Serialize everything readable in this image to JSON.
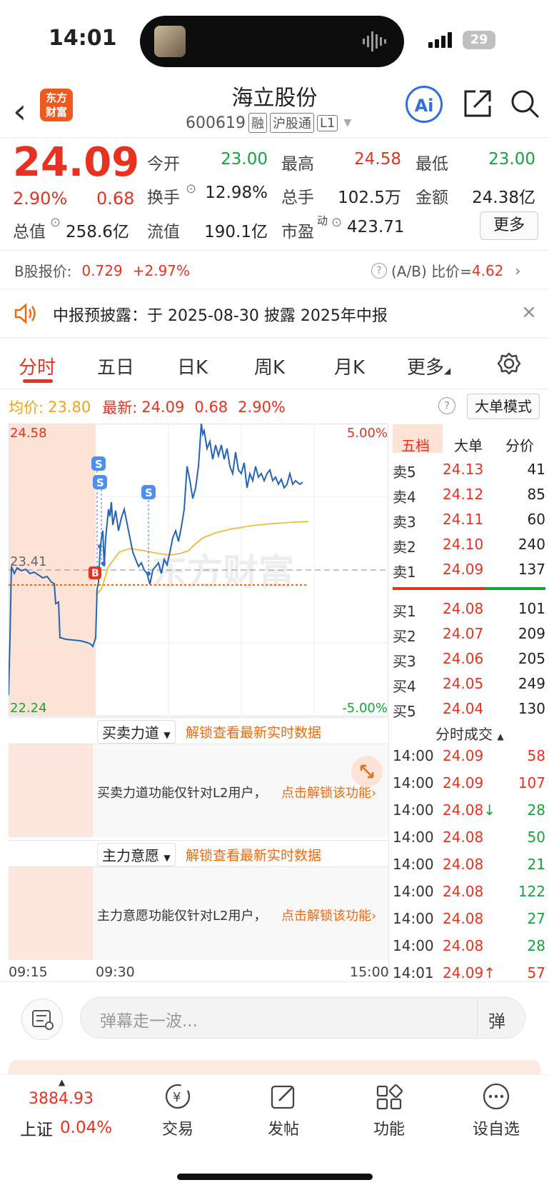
{
  "status_bar": {
    "time": "14:01",
    "battery": "29"
  },
  "header": {
    "logo_line1": "东方",
    "logo_line2": "财富",
    "name": "海立股份",
    "code": "600619",
    "tags": [
      "融",
      "沪股通",
      "L1"
    ],
    "ai_label": "Ai"
  },
  "quote": {
    "price": "24.09",
    "pct": "2.90%",
    "change": "0.68",
    "rows": [
      [
        {
          "label": "今开",
          "value": "23.00",
          "color": "green"
        },
        {
          "label": "最高",
          "value": "24.58",
          "color": "red"
        },
        {
          "label": "最低",
          "value": "23.00",
          "color": "green"
        }
      ],
      [
        {
          "label": "换手",
          "value": "12.98%",
          "color": "black"
        },
        {
          "label": "总手",
          "value": "102.5万",
          "color": "black"
        },
        {
          "label": "金额",
          "value": "24.38亿",
          "color": "black"
        }
      ],
      [
        {
          "label": "总值",
          "value": "258.6亿",
          "color": "black"
        },
        {
          "label": "流值",
          "value": "190.1亿",
          "color": "black"
        },
        {
          "label": "市盈",
          "value": "423.71",
          "color": "black"
        }
      ]
    ],
    "pe_sup": "动",
    "more": "更多"
  },
  "bshare": {
    "label": "B股报价:",
    "price": "0.729",
    "pct": "+2.97%",
    "ratio_label": "(A/B) 比价=",
    "ratio": "4.62"
  },
  "notice": {
    "text": "中报预披露：于 2025-08-30 披露 2025年中报"
  },
  "tabs": [
    "分时",
    "五日",
    "日K",
    "周K",
    "月K",
    "更多"
  ],
  "summary": {
    "avg_label": "均价:",
    "avg": "23.80",
    "latest_label": "最新:",
    "latest": "24.09",
    "change": "0.68",
    "pct": "2.90%",
    "big_order": "大单模式"
  },
  "chart": {
    "high": "24.58",
    "low": "22.24",
    "mid": "23.41",
    "pct_high": "5.00%",
    "pct_low": "-5.00%",
    "watermark": "东方财富",
    "markers": [
      "S",
      "S",
      "S",
      "B"
    ],
    "time_labels": [
      "09:15",
      "09:30",
      "15:00"
    ]
  },
  "chart_data": {
    "type": "line",
    "title": "",
    "ylim": [
      22.24,
      24.58
    ],
    "series": [
      {
        "values": [
          23.41,
          23.38,
          23.32,
          23.3,
          22.9,
          22.85,
          23.3,
          23.95,
          23.5,
          24.1,
          24.57,
          24.35,
          24.2,
          24.15,
          24.12,
          24.09
        ]
      },
      {
        "values": [
          23.4,
          23.41,
          23.44,
          23.55,
          23.62,
          23.68,
          23.72,
          23.76,
          23.78,
          23.8
        ]
      }
    ]
  },
  "orderbook": {
    "tabs": [
      "五档",
      "大单",
      "分价"
    ],
    "sells": [
      {
        "label": "卖5",
        "price": "24.13",
        "vol": "41"
      },
      {
        "label": "卖4",
        "price": "24.12",
        "vol": "85"
      },
      {
        "label": "卖3",
        "price": "24.11",
        "vol": "60"
      },
      {
        "label": "卖2",
        "price": "24.10",
        "vol": "240"
      },
      {
        "label": "卖1",
        "price": "24.09",
        "vol": "137"
      }
    ],
    "buys": [
      {
        "label": "买1",
        "price": "24.08",
        "vol": "101"
      },
      {
        "label": "买2",
        "price": "24.07",
        "vol": "209"
      },
      {
        "label": "买3",
        "price": "24.06",
        "vol": "205"
      },
      {
        "label": "买4",
        "price": "24.05",
        "vol": "249"
      },
      {
        "label": "买5",
        "price": "24.04",
        "vol": "130"
      }
    ]
  },
  "panels": {
    "p1_title": "买卖力道",
    "p1_unlock": "解锁查看最新实时数据",
    "p1_msg": "买卖力道功能仅针对L2用户，",
    "p1_link": "点击解锁该功能",
    "p2_title": "主力意愿",
    "p2_unlock": "解锁查看最新实时数据",
    "p2_msg": "主力意愿功能仅针对L2用户，",
    "p2_link": "点击解锁该功能"
  },
  "trades": {
    "title": "分时成交",
    "rows": [
      {
        "time": "14:00",
        "price": "24.09",
        "vol": "58",
        "pc": "red",
        "vc": "red",
        "arrow": ""
      },
      {
        "time": "14:00",
        "price": "24.09",
        "vol": "107",
        "pc": "red",
        "vc": "red",
        "arrow": ""
      },
      {
        "time": "14:00",
        "price": "24.08",
        "vol": "28",
        "pc": "red",
        "vc": "green",
        "arrow": "↓"
      },
      {
        "time": "14:00",
        "price": "24.08",
        "vol": "50",
        "pc": "red",
        "vc": "green",
        "arrow": ""
      },
      {
        "time": "14:00",
        "price": "24.08",
        "vol": "21",
        "pc": "red",
        "vc": "green",
        "arrow": ""
      },
      {
        "time": "14:00",
        "price": "24.08",
        "vol": "122",
        "pc": "red",
        "vc": "green",
        "arrow": ""
      },
      {
        "time": "14:00",
        "price": "24.08",
        "vol": "27",
        "pc": "red",
        "vc": "green",
        "arrow": ""
      },
      {
        "time": "14:00",
        "price": "24.08",
        "vol": "28",
        "pc": "red",
        "vc": "green",
        "arrow": ""
      },
      {
        "time": "14:01",
        "price": "24.09",
        "vol": "57",
        "pc": "red",
        "vc": "red",
        "arrow": "↑"
      }
    ]
  },
  "danmaku": {
    "placeholder": "弹幕走一波...",
    "button": "弹"
  },
  "bottom": {
    "index_value": "3884.93",
    "index_name": "上证",
    "index_pct": "0.04%",
    "items": [
      "交易",
      "发帖",
      "功能",
      "设自选"
    ]
  },
  "colors": {
    "up": "#e8321f",
    "down": "#14a53a",
    "accent": "#ee6a12",
    "line": "#2563b5",
    "avg": "#f5b21d"
  }
}
